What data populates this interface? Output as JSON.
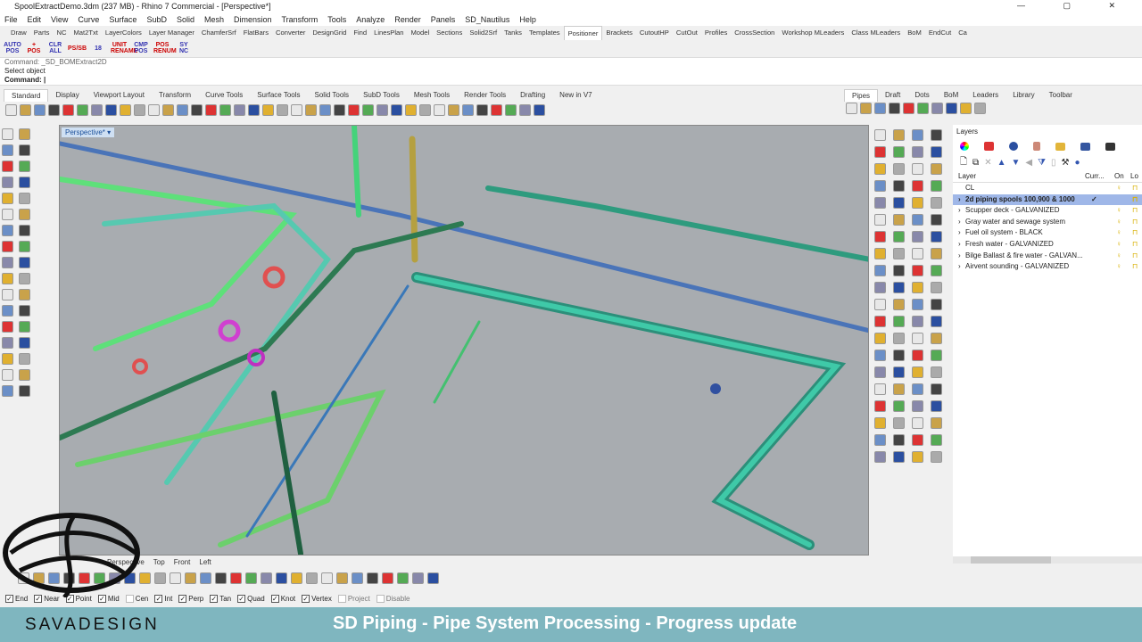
{
  "window": {
    "title": "SpoolExtractDemo.3dm (237 MB) - Rhino 7 Commercial - [Perspective*]"
  },
  "menu": [
    "File",
    "Edit",
    "View",
    "Curve",
    "Surface",
    "SubD",
    "Solid",
    "Mesh",
    "Dimension",
    "Transform",
    "Tools",
    "Analyze",
    "Render",
    "Panels",
    "SD_Nautilus",
    "Help"
  ],
  "toolbar_tabs": [
    "Draw",
    "Parts",
    "NC",
    "Mat2Txt",
    "LayerColors",
    "Layer Manager",
    "ChamferSrf",
    "FlatBars",
    "Converter",
    "DesignGrid",
    "Find",
    "LinesPlan",
    "Model",
    "Sections",
    "Solid2Srf",
    "Tanks",
    "Templates",
    "Positioner",
    "Brackets",
    "CutoutHP",
    "CutOut",
    "Profiles",
    "CrossSection",
    "Workshop MLeaders",
    "Class MLeaders",
    "BoM",
    "EndCut",
    "Ca"
  ],
  "active_toolbar_tab": "Positioner",
  "tool_buttons": [
    "AUTO POS",
    "+ POS",
    "CLR ALL",
    "PS/SB",
    "18",
    "UNIT RENAME",
    "CMP POS",
    "POS RENUM",
    "SY NC"
  ],
  "command": {
    "history1": "Command: _SD_BOMExtract2D",
    "history2": "Select object",
    "prompt": "Command:"
  },
  "toolbar_tabs2": [
    "Standard",
    "Display",
    "Viewport Layout",
    "Transform",
    "Curve Tools",
    "Surface Tools",
    "Solid Tools",
    "SubD Tools",
    "Mesh Tools",
    "Render Tools",
    "Drafting",
    "New in V7"
  ],
  "panel_tabs": [
    "Pipes",
    "Draft",
    "Dots",
    "BoM",
    "Leaders",
    "Library",
    "Toolbar"
  ],
  "viewport": {
    "label": "Perspective*"
  },
  "layers": {
    "title": "Layers",
    "columns": [
      "Layer",
      "Curr...",
      "On",
      "Lo"
    ],
    "rows": [
      {
        "name": "CL",
        "current": false
      },
      {
        "name": "2d piping spools 100,900 & 1000",
        "current": true,
        "check": "✓"
      },
      {
        "name": "Scupper deck - GALVANIZED",
        "current": false
      },
      {
        "name": "Gray water and sewage system",
        "current": false
      },
      {
        "name": "Fuel oil system - BLACK",
        "current": false
      },
      {
        "name": "Fresh water - GALVANIZED",
        "current": false
      },
      {
        "name": "Bilge Ballast & fire water - GALVAN...",
        "current": false
      },
      {
        "name": "Airvent sounding - GALVANIZED",
        "current": false
      }
    ]
  },
  "viewport_tabs": [
    "Perspective",
    "Top",
    "Front",
    "Left"
  ],
  "osnaps": [
    {
      "label": "End",
      "on": true
    },
    {
      "label": "Near",
      "on": true
    },
    {
      "label": "Point",
      "on": true
    },
    {
      "label": "Mid",
      "on": true
    },
    {
      "label": "Cen",
      "on": false
    },
    {
      "label": "Int",
      "on": true
    },
    {
      "label": "Perp",
      "on": true
    },
    {
      "label": "Tan",
      "on": true
    },
    {
      "label": "Quad",
      "on": true
    },
    {
      "label": "Knot",
      "on": true
    },
    {
      "label": "Vertex",
      "on": true
    },
    {
      "label": "Project",
      "on": false
    },
    {
      "label": "Disable",
      "on": false
    }
  ],
  "banner": {
    "brand": "SAVADESIGN",
    "headline": "SD Piping - Pipe System Processing - Progress update",
    "color": "#7fb6bf"
  }
}
